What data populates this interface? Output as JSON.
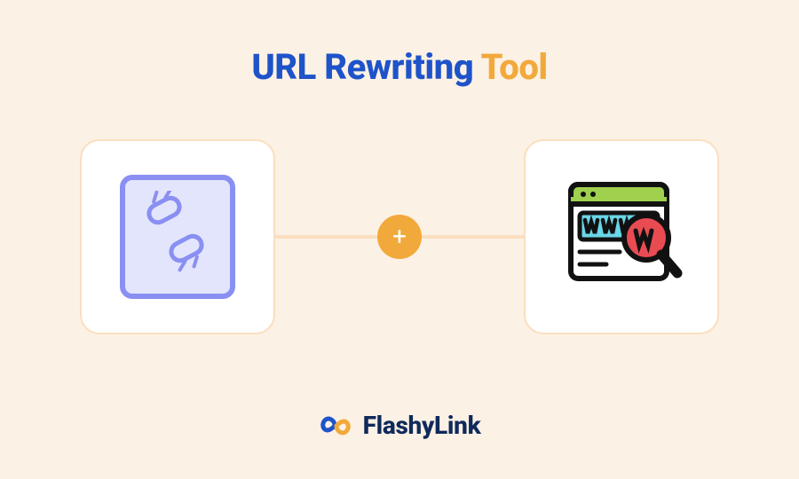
{
  "header": {
    "title_part1": "URL Rewriting",
    "title_part2": "Tool"
  },
  "stage": {
    "left_icon": "broken-link-icon",
    "right_icon": "www-search-icon",
    "plus_symbol": "+"
  },
  "footer": {
    "brand": "FlashyLink",
    "logo_icon": "infinity-logo-icon"
  },
  "colors": {
    "background": "#fcf1e5",
    "primary_blue": "#1e53c9",
    "accent_orange": "#f2a93b",
    "card_border": "#fadfbf",
    "icon_lavender": "#8a8ff2",
    "icon_lavender_bg": "#e3e5fc",
    "brand_navy": "#0f2a5b"
  }
}
